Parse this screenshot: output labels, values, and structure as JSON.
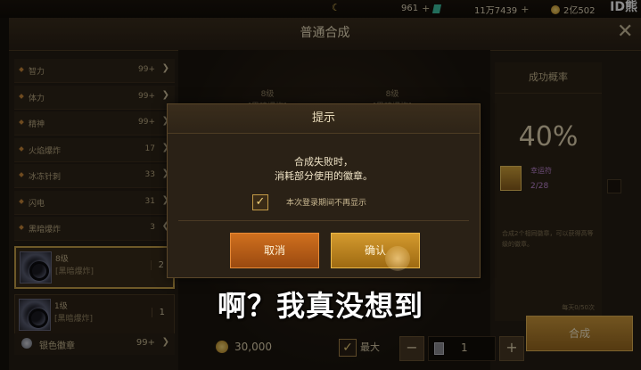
{
  "topbar": {
    "currency1": "961",
    "currency2": "11万7439",
    "currency3": "2亿502",
    "watermark": "ID熊"
  },
  "panel": {
    "title": "普通合成"
  },
  "stats": [
    {
      "name": "智力",
      "value": "99+"
    },
    {
      "name": "体力",
      "value": "99+"
    },
    {
      "name": "精神",
      "value": "99+"
    },
    {
      "name": "火焰爆炸",
      "value": "17"
    },
    {
      "name": "冰冻针刺",
      "value": "33"
    },
    {
      "name": "闪电",
      "value": "31"
    },
    {
      "name": "黑暗爆炸",
      "value": "3"
    }
  ],
  "items": [
    {
      "level": "8级",
      "sub": "[黑暗爆炸]",
      "count": "2"
    },
    {
      "level": "1级",
      "sub": "[黑暗爆炸]",
      "count": "1"
    }
  ],
  "silver": {
    "name": "银色徽章",
    "value": "99+"
  },
  "slots": [
    {
      "level": "8级",
      "sub": "[黑暗爆炸]"
    },
    {
      "level": "8级",
      "sub": "[黑暗爆炸]"
    }
  ],
  "right": {
    "header": "成功概率",
    "percent": "40%",
    "lucky": "幸运符",
    "lucky_count": "2/28",
    "desc": "合成2个相同徽章，可以获得高等级的徽章。",
    "daily": "每天0/50次"
  },
  "bottom": {
    "cost": "30,000",
    "max_label": "最大",
    "quantity": "1",
    "synth_label": "合成"
  },
  "dialog": {
    "title": "提示",
    "line1": "合成失败时，",
    "line2": "消耗部分使用的徽章。",
    "check_label": "本次登录期间不再显示",
    "cancel": "取消",
    "confirm": "确认"
  },
  "subtitle": "啊？我真没想到"
}
